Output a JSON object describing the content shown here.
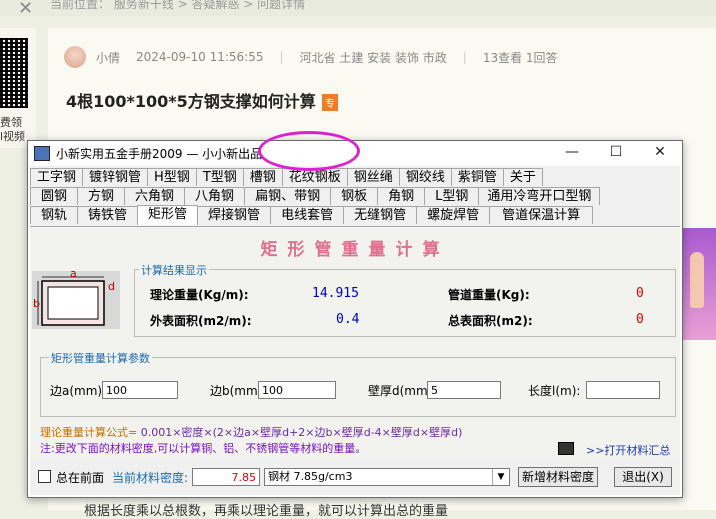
{
  "page": {
    "breadcrumb": "当前位置： 服务新干线 > 答疑解惑 > 问题详情",
    "left_rail_text": [
      "费领",
      "l视频"
    ],
    "author": "小倩",
    "datetime": "2024-09-10 11:56:55",
    "location_tags": "河北省  土建 安装 装饰 市政",
    "stats": "13查看  1回答",
    "question_title": "4根100*100*5方钢支撑如何计算",
    "question_tag": "专",
    "bottom_text": "根据长度乘以总根数，再乘以理论重量，就可以计算出总的重量"
  },
  "dialog": {
    "title": "小新实用五金手册2009 — 小小新出品",
    "window_buttons": {
      "minimize": "—",
      "maximize": "☐",
      "close": "✕"
    },
    "tab_rows": [
      [
        "工字钢",
        "镀锌钢管",
        "H型钢",
        "T型钢",
        "槽钢",
        "花纹钢板",
        "钢丝绳",
        "钢绞线",
        "紫铜管",
        "关于"
      ],
      [
        "圆钢",
        "方钢",
        "六角钢",
        "八角钢",
        "扁钢、带钢",
        "钢板",
        "角钢",
        "L型钢",
        "通用冷弯开口型钢"
      ],
      [
        "钢轨",
        "铸铁管",
        "矩形管",
        "焊接钢管",
        "电线套管",
        "无缝钢管",
        "螺旋焊管",
        "管道保温计算"
      ]
    ],
    "active_tab": "矩形管",
    "panel_title": "矩形管重量计算",
    "diagram_labels": {
      "a": "a",
      "b": "b",
      "d": "d"
    },
    "results": {
      "group_title": "计算结果显示",
      "theoretical_weight_label": "理论重量(Kg/m):",
      "theoretical_weight_value": "14.915",
      "pipe_weight_label": "管道重量(Kg):",
      "pipe_weight_value": "0",
      "outer_area_label": "外表面积(m2/m):",
      "outer_area_value": "0.4",
      "total_area_label": "总表面积(m2):",
      "total_area_value": "0"
    },
    "params": {
      "group_title": "矩形管重量计算参数",
      "side_a_label": "边a(mm):",
      "side_a_value": "100",
      "side_b_label": "边b(mm):",
      "side_b_value": "100",
      "thickness_label": "壁厚d(mm):",
      "thickness_value": "5",
      "length_label": "长度l(m):",
      "length_value": ""
    },
    "formula_key": "理论重量计算公式=",
    "formula_text": "0.001×密度×(2×边a×壁厚d+2×边b×壁厚d-4×壁厚d×壁厚d)",
    "note": "注:更改下面的材料密度,可以计算铜、铝、不锈钢管等材料的重量。",
    "summary_link": ">>打开材料汇总",
    "bottom": {
      "always_on_top_label": "总在前面",
      "density_label": "当前材料密度:",
      "density_value": "7.85",
      "material_select": "钢材 7.85g/cm3",
      "add_material_button": "新增材料密度",
      "exit_button": "退出(X)"
    }
  },
  "colors": {
    "panel_title": "#e07090",
    "value_blue": "#0000cc",
    "value_red": "#e00000",
    "highlight_circle": "#e020d0"
  }
}
